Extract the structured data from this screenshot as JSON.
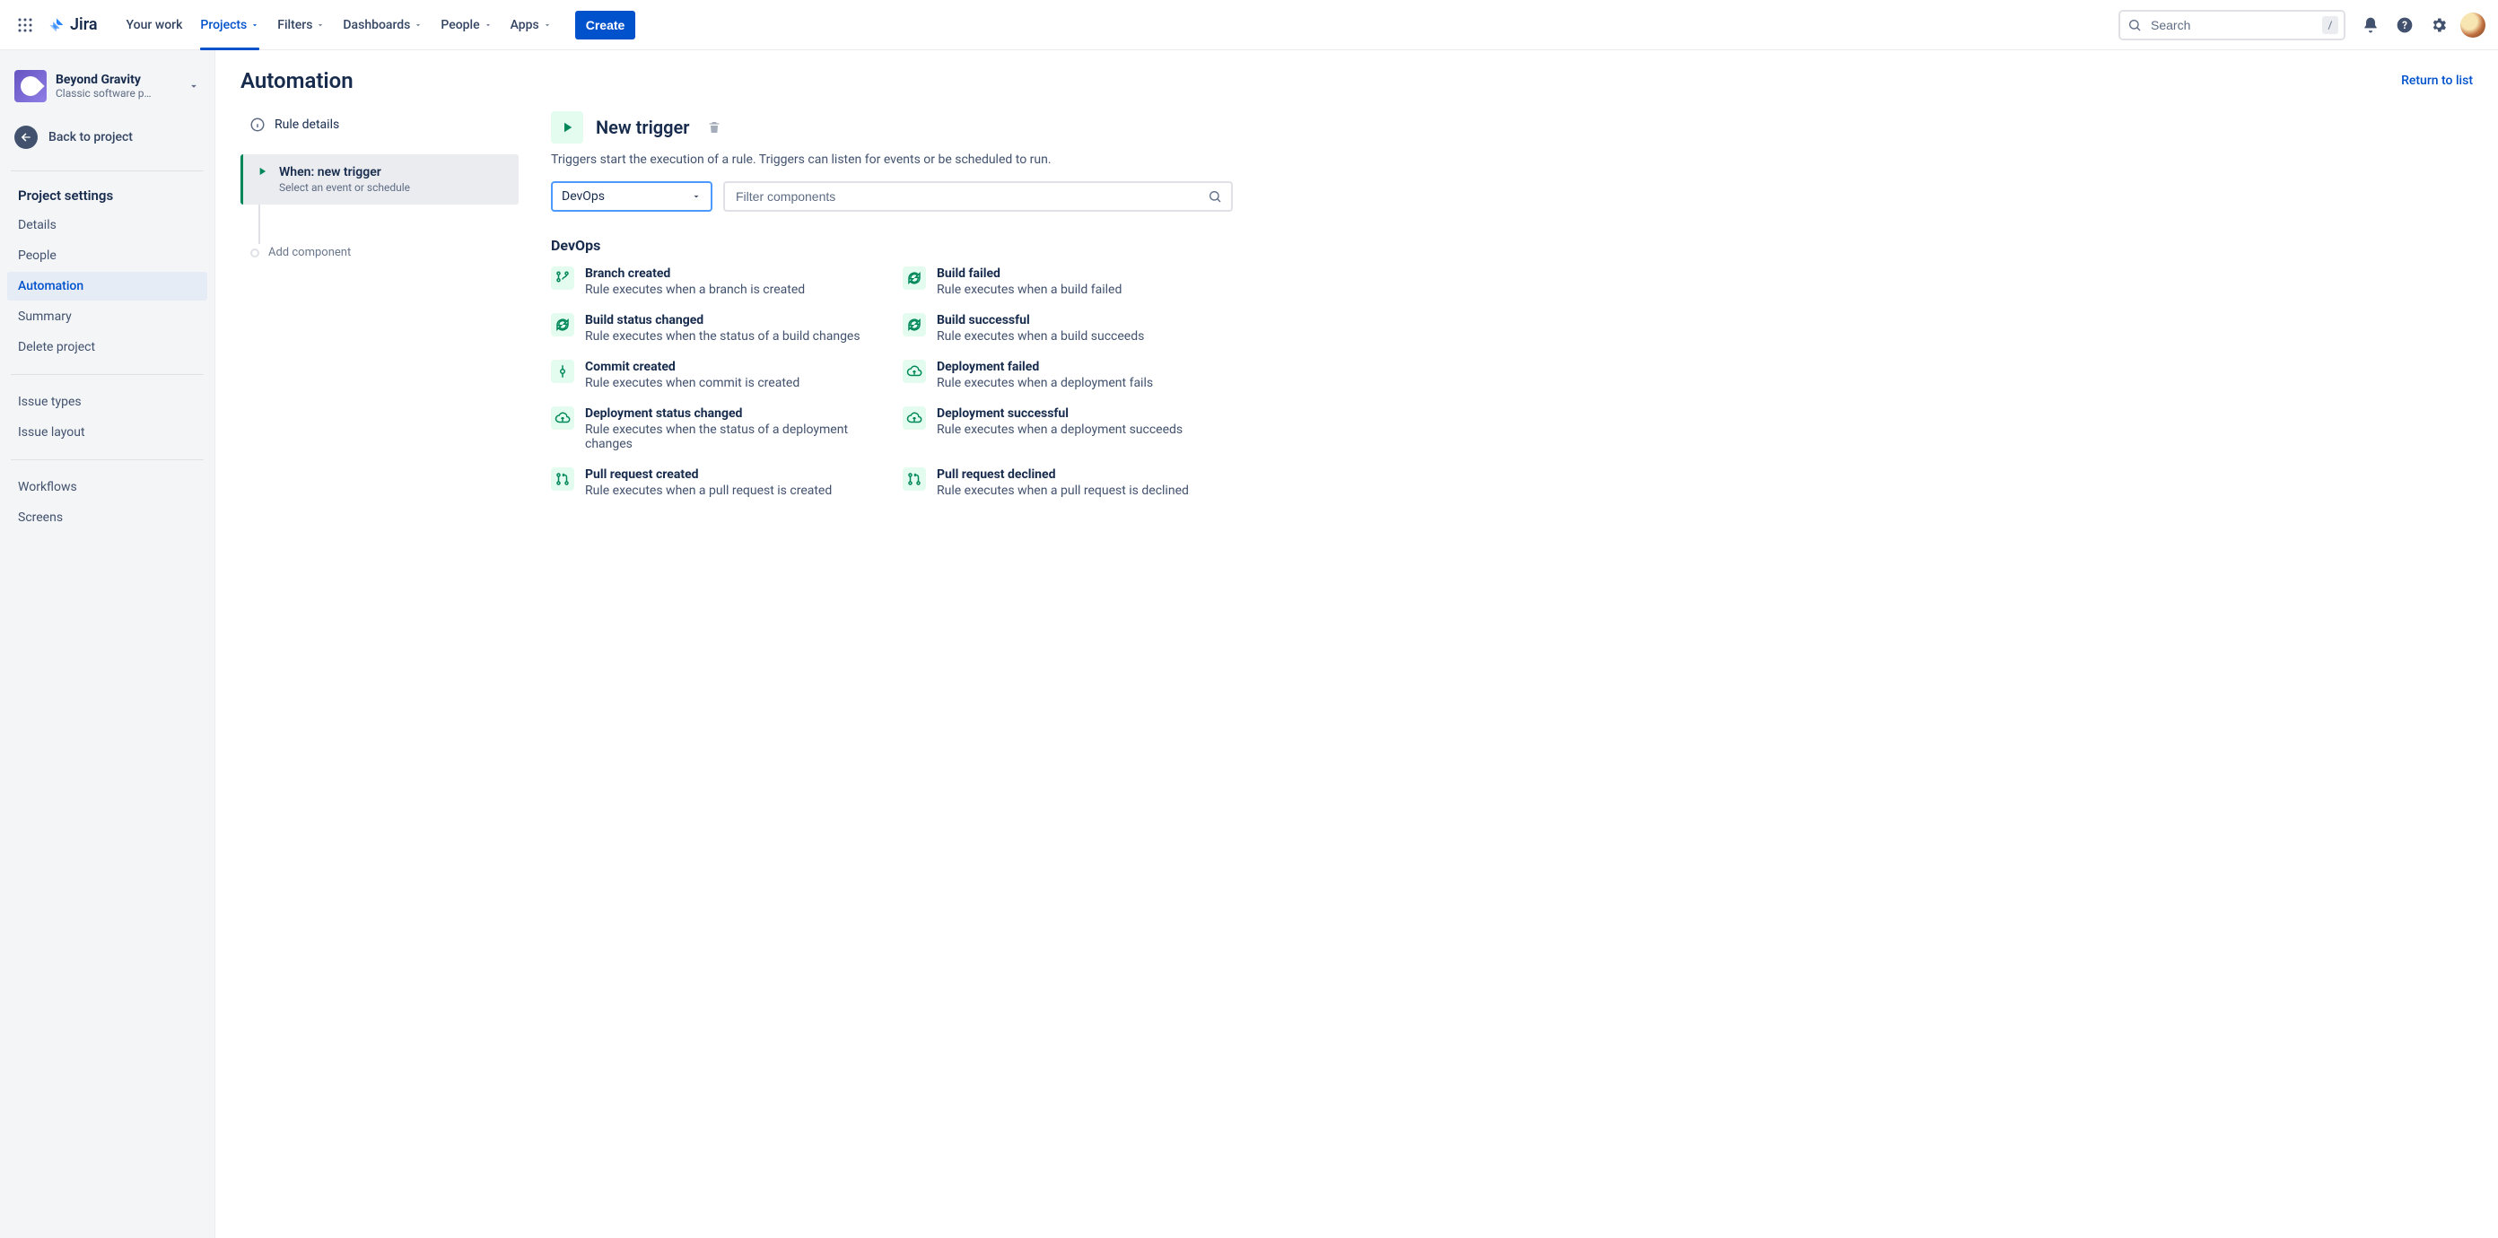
{
  "app": {
    "name": "Jira"
  },
  "topnav": {
    "items": [
      {
        "label": "Your work",
        "selected": false,
        "has_menu": false
      },
      {
        "label": "Projects",
        "selected": true,
        "has_menu": true
      },
      {
        "label": "Filters",
        "selected": false,
        "has_menu": true
      },
      {
        "label": "Dashboards",
        "selected": false,
        "has_menu": true
      },
      {
        "label": "People",
        "selected": false,
        "has_menu": true
      },
      {
        "label": "Apps",
        "selected": false,
        "has_menu": true
      }
    ],
    "create_label": "Create",
    "search_placeholder": "Search",
    "kbd_hint": "/"
  },
  "sidebar": {
    "project": {
      "name": "Beyond Gravity",
      "type": "Classic software p…"
    },
    "back_label": "Back to project",
    "section_title": "Project settings",
    "primary": [
      {
        "label": "Details"
      },
      {
        "label": "People"
      },
      {
        "label": "Automation",
        "selected": true
      },
      {
        "label": "Summary"
      },
      {
        "label": "Delete project"
      }
    ],
    "secondary": [
      {
        "label": "Issue types"
      },
      {
        "label": "Issue layout"
      }
    ],
    "tertiary": [
      {
        "label": "Workflows"
      },
      {
        "label": "Screens"
      }
    ]
  },
  "page": {
    "title": "Automation",
    "return_link": "Return to list"
  },
  "rule_builder": {
    "rule_details_label": "Rule details",
    "step_title": "When: new trigger",
    "step_subtitle": "Select an event or schedule",
    "add_component_label": "Add component"
  },
  "trigger_panel": {
    "title": "New trigger",
    "description": "Triggers start the execution of a rule. Triggers can listen for events or be scheduled to run.",
    "select_value": "DevOps",
    "filter_placeholder": "Filter components",
    "category_title": "DevOps",
    "triggers": [
      {
        "icon": "branch",
        "name": "Branch created",
        "desc": "Rule executes when a branch is created"
      },
      {
        "icon": "cycle",
        "name": "Build failed",
        "desc": "Rule executes when a build failed"
      },
      {
        "icon": "cycle",
        "name": "Build status changed",
        "desc": "Rule executes when the status of a build changes"
      },
      {
        "icon": "cycle",
        "name": "Build successful",
        "desc": "Rule executes when a build succeeds"
      },
      {
        "icon": "commit",
        "name": "Commit created",
        "desc": "Rule executes when commit is created"
      },
      {
        "icon": "cloud",
        "name": "Deployment failed",
        "desc": "Rule executes when a deployment fails"
      },
      {
        "icon": "cloud",
        "name": "Deployment status changed",
        "desc": "Rule executes when the status of a deployment changes"
      },
      {
        "icon": "cloud",
        "name": "Deployment successful",
        "desc": "Rule executes when a deployment succeeds"
      },
      {
        "icon": "pr",
        "name": "Pull request created",
        "desc": "Rule executes when a pull request is created"
      },
      {
        "icon": "pr",
        "name": "Pull request declined",
        "desc": "Rule executes when a pull request is declined"
      }
    ]
  }
}
